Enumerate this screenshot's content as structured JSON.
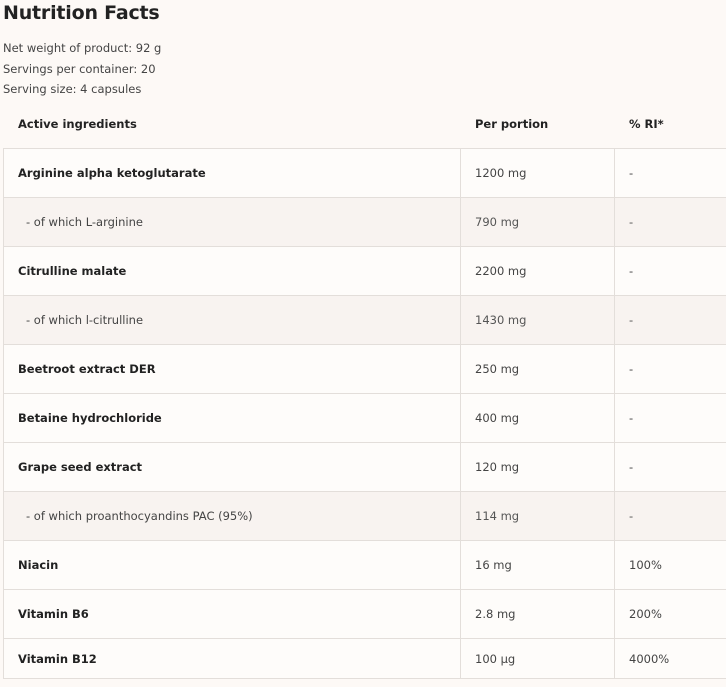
{
  "title": "Nutrition Facts",
  "meta": {
    "net_weight": "Net weight of product: 92 g",
    "servings_per_container": "Servings per container: 20",
    "serving_size": "Serving size: 4 capsules"
  },
  "table": {
    "headers": {
      "ingredient": "Active ingredients",
      "portion": "Per portion",
      "ri": "% RI*"
    },
    "rows": [
      {
        "name": "Arginine alpha ketoglutarate",
        "portion": "1200 mg",
        "ri": "-",
        "sub": false
      },
      {
        "name": "- of which L-arginine",
        "portion": "790 mg",
        "ri": "-",
        "sub": true
      },
      {
        "name": "Citrulline malate",
        "portion": "2200 mg",
        "ri": "-",
        "sub": false
      },
      {
        "name": "- of which l-citrulline",
        "portion": "1430 mg",
        "ri": "-",
        "sub": true
      },
      {
        "name": "Beetroot extract DER",
        "portion": "250 mg",
        "ri": "-",
        "sub": false
      },
      {
        "name": "Betaine hydrochloride",
        "portion": "400 mg",
        "ri": "-",
        "sub": false
      },
      {
        "name": "Grape seed extract",
        "portion": "120 mg",
        "ri": "-",
        "sub": false
      },
      {
        "name": "- of which proanthocyandins PAC (95%)",
        "portion": "114 mg",
        "ri": "-",
        "sub": true
      },
      {
        "name": "Niacin",
        "portion": "16 mg",
        "ri": "100%",
        "sub": false
      },
      {
        "name": "Vitamin B6",
        "portion": "2.8 mg",
        "ri": "200%",
        "sub": false
      },
      {
        "name": "Vitamin B12",
        "portion": "100 µg",
        "ri": "4000%",
        "sub": false
      }
    ]
  }
}
